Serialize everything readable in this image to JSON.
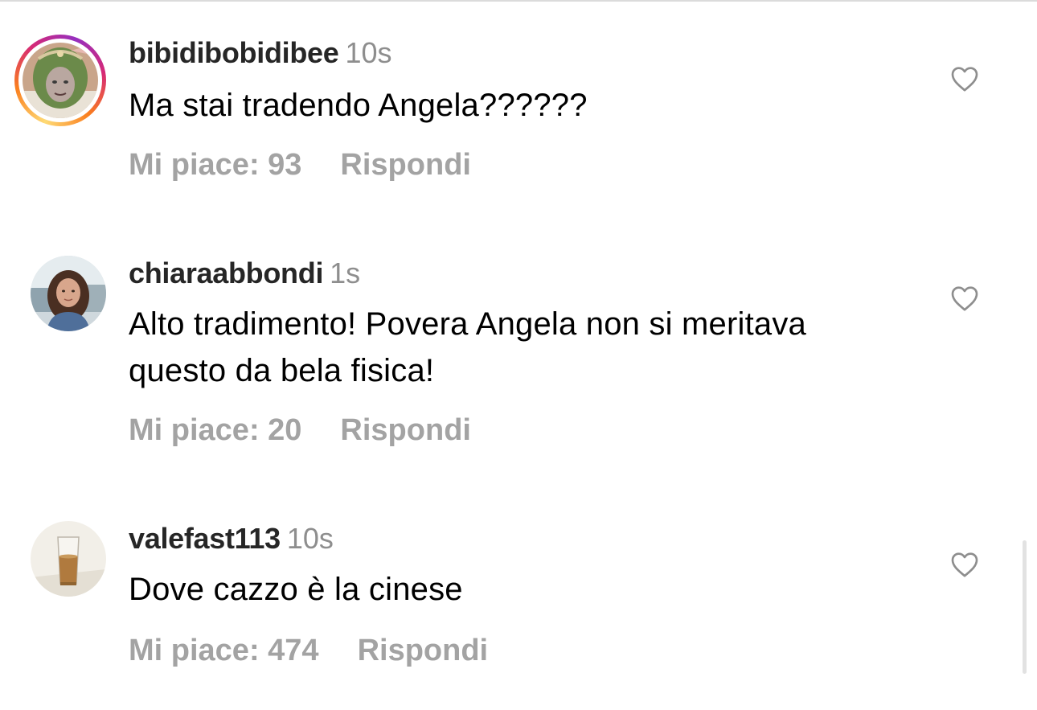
{
  "comments": [
    {
      "username": "bibidibobidibee",
      "time": "10s",
      "text": "Ma stai tradendo Angela??????",
      "likes_label": "Mi piace: 93",
      "reply_label": "Rispondi",
      "has_story_ring": true,
      "avatar_icon": "avatar-green-hair"
    },
    {
      "username": "chiaraabbondi",
      "time": "1s",
      "text": "Alto tradimento! Povera Angela non si meritava questo da bela fisica!",
      "likes_label": "Mi piace: 20",
      "reply_label": "Rispondi",
      "has_story_ring": false,
      "avatar_icon": "avatar-woman-photo"
    },
    {
      "username": "valefast113",
      "time": "10s",
      "text": "Dove cazzo è la cinese",
      "likes_label": "Mi piace: 474",
      "reply_label": "Rispondi",
      "has_story_ring": false,
      "avatar_icon": "avatar-glass-photo"
    }
  ],
  "colors": {
    "username": "#262626",
    "secondary_text": "#8e8e8e",
    "action_text": "#a3a3a3",
    "heart_stroke": "#8e8e8e",
    "ring_gradient": [
      "#feda75",
      "#fa7e1e",
      "#d62976",
      "#962fbf"
    ]
  },
  "icons": {
    "like": "heart-outline-icon"
  }
}
